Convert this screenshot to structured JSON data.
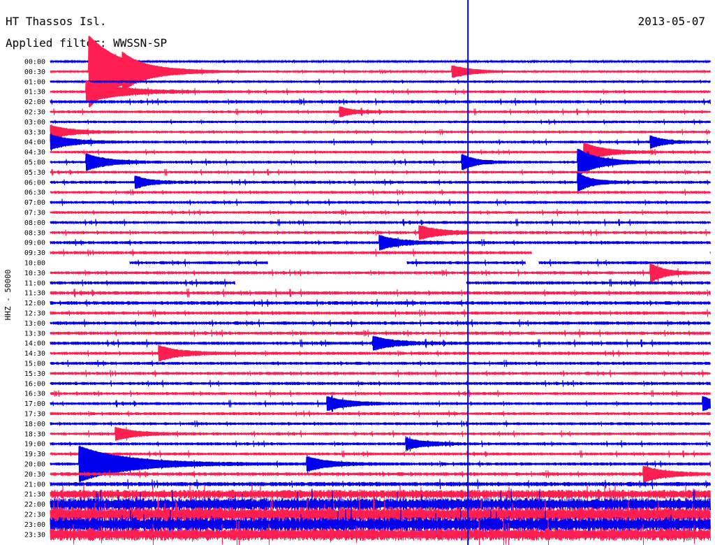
{
  "header": {
    "station": "HT Thassos Isl.",
    "date": "2013-05-07",
    "filter": "Applied filter: WWSSN-SP"
  },
  "chart_data": {
    "type": "line",
    "title": "HT Thassos Isl.",
    "date": "2013-05-07",
    "subtitle": "Applied filter: WWSSN-SP",
    "ylabel": "HHZ - 50000",
    "xlabel": "",
    "row_labels": [
      "00:00",
      "00:30",
      "01:00",
      "01:30",
      "02:00",
      "02:30",
      "03:00",
      "03:30",
      "04:00",
      "04:30",
      "05:00",
      "05:30",
      "06:00",
      "06:30",
      "07:00",
      "07:30",
      "08:00",
      "08:30",
      "09:00",
      "09:30",
      "10:00",
      "10:30",
      "11:00",
      "11:30",
      "12:00",
      "12:30",
      "13:00",
      "13:30",
      "14:00",
      "14:30",
      "15:00",
      "15:30",
      "16:00",
      "16:30",
      "17:00",
      "17:30",
      "18:00",
      "18:30",
      "19:00",
      "19:30",
      "20:00",
      "20:30",
      "21:00",
      "21:30",
      "22:00",
      "22:30",
      "23:00",
      "23:30"
    ],
    "row_minutes": 30,
    "colors": {
      "even_rows": "#0000ee",
      "odd_rows": "#ff1e50",
      "marker": "#0000ee"
    },
    "marker_line_fraction": 0.633,
    "noise_level": [
      0.8,
      0.9,
      1.2,
      1.4,
      1.6,
      1.4,
      1.3,
      1.3,
      1.4,
      1.3,
      1.4,
      1.4,
      1.5,
      1.4,
      1.5,
      1.4,
      1.5,
      1.5,
      1.6,
      1.6,
      1.6,
      1.6,
      1.7,
      1.8,
      1.8,
      1.7,
      1.7,
      1.7,
      1.7,
      1.6,
      1.6,
      1.6,
      1.6,
      1.5,
      1.5,
      1.5,
      1.5,
      1.5,
      1.5,
      1.5,
      1.6,
      1.8,
      2.2,
      4.5,
      6.5,
      7.5,
      7.5,
      6.5
    ],
    "gaps": [
      {
        "row": 19,
        "start": 0.73,
        "end": 1.0
      },
      {
        "row": 20,
        "start": 0.0,
        "end": 0.12
      },
      {
        "row": 20,
        "start": 0.33,
        "end": 0.54
      },
      {
        "row": 20,
        "start": 0.72,
        "end": 0.74
      },
      {
        "row": 22,
        "start": 0.28,
        "end": 0.63
      }
    ],
    "events": [
      {
        "row": 1,
        "pos": 0.06,
        "amp": 50,
        "decay": 0.05
      },
      {
        "row": 1,
        "pos": 0.11,
        "amp": 9,
        "decay": 0.02
      },
      {
        "row": 1,
        "pos": 0.61,
        "amp": 8,
        "decay": 0.03
      },
      {
        "row": 3,
        "pos": 0.055,
        "amp": 14,
        "decay": 0.05
      },
      {
        "row": 5,
        "pos": 0.44,
        "amp": 6,
        "decay": 0.02
      },
      {
        "row": 7,
        "pos": 0.0,
        "amp": 9,
        "decay": 0.03
      },
      {
        "row": 8,
        "pos": 0.0,
        "amp": 10,
        "decay": 0.03
      },
      {
        "row": 8,
        "pos": 0.91,
        "amp": 8,
        "decay": 0.02
      },
      {
        "row": 9,
        "pos": 0.81,
        "amp": 12,
        "decay": 0.03
      },
      {
        "row": 10,
        "pos": 0.055,
        "amp": 11,
        "decay": 0.03
      },
      {
        "row": 10,
        "pos": 0.625,
        "amp": 10,
        "decay": 0.02
      },
      {
        "row": 10,
        "pos": 0.8,
        "amp": 18,
        "decay": 0.03
      },
      {
        "row": 12,
        "pos": 0.13,
        "amp": 8,
        "decay": 0.02
      },
      {
        "row": 12,
        "pos": 0.8,
        "amp": 12,
        "decay": 0.02
      },
      {
        "row": 17,
        "pos": 0.56,
        "amp": 9,
        "decay": 0.03
      },
      {
        "row": 18,
        "pos": 0.5,
        "amp": 9,
        "decay": 0.03
      },
      {
        "row": 21,
        "pos": 0.91,
        "amp": 12,
        "decay": 0.02
      },
      {
        "row": 28,
        "pos": 0.49,
        "amp": 9,
        "decay": 0.03
      },
      {
        "row": 29,
        "pos": 0.165,
        "amp": 10,
        "decay": 0.03
      },
      {
        "row": 34,
        "pos": 0.42,
        "amp": 9,
        "decay": 0.03
      },
      {
        "row": 34,
        "pos": 0.99,
        "amp": 9,
        "decay": 0.02
      },
      {
        "row": 37,
        "pos": 0.1,
        "amp": 8,
        "decay": 0.03
      },
      {
        "row": 38,
        "pos": 0.54,
        "amp": 7,
        "decay": 0.03
      },
      {
        "row": 40,
        "pos": 0.045,
        "amp": 24,
        "decay": 0.07
      },
      {
        "row": 40,
        "pos": 0.39,
        "amp": 9,
        "decay": 0.03
      },
      {
        "row": 41,
        "pos": 0.9,
        "amp": 10,
        "decay": 0.03
      }
    ]
  }
}
